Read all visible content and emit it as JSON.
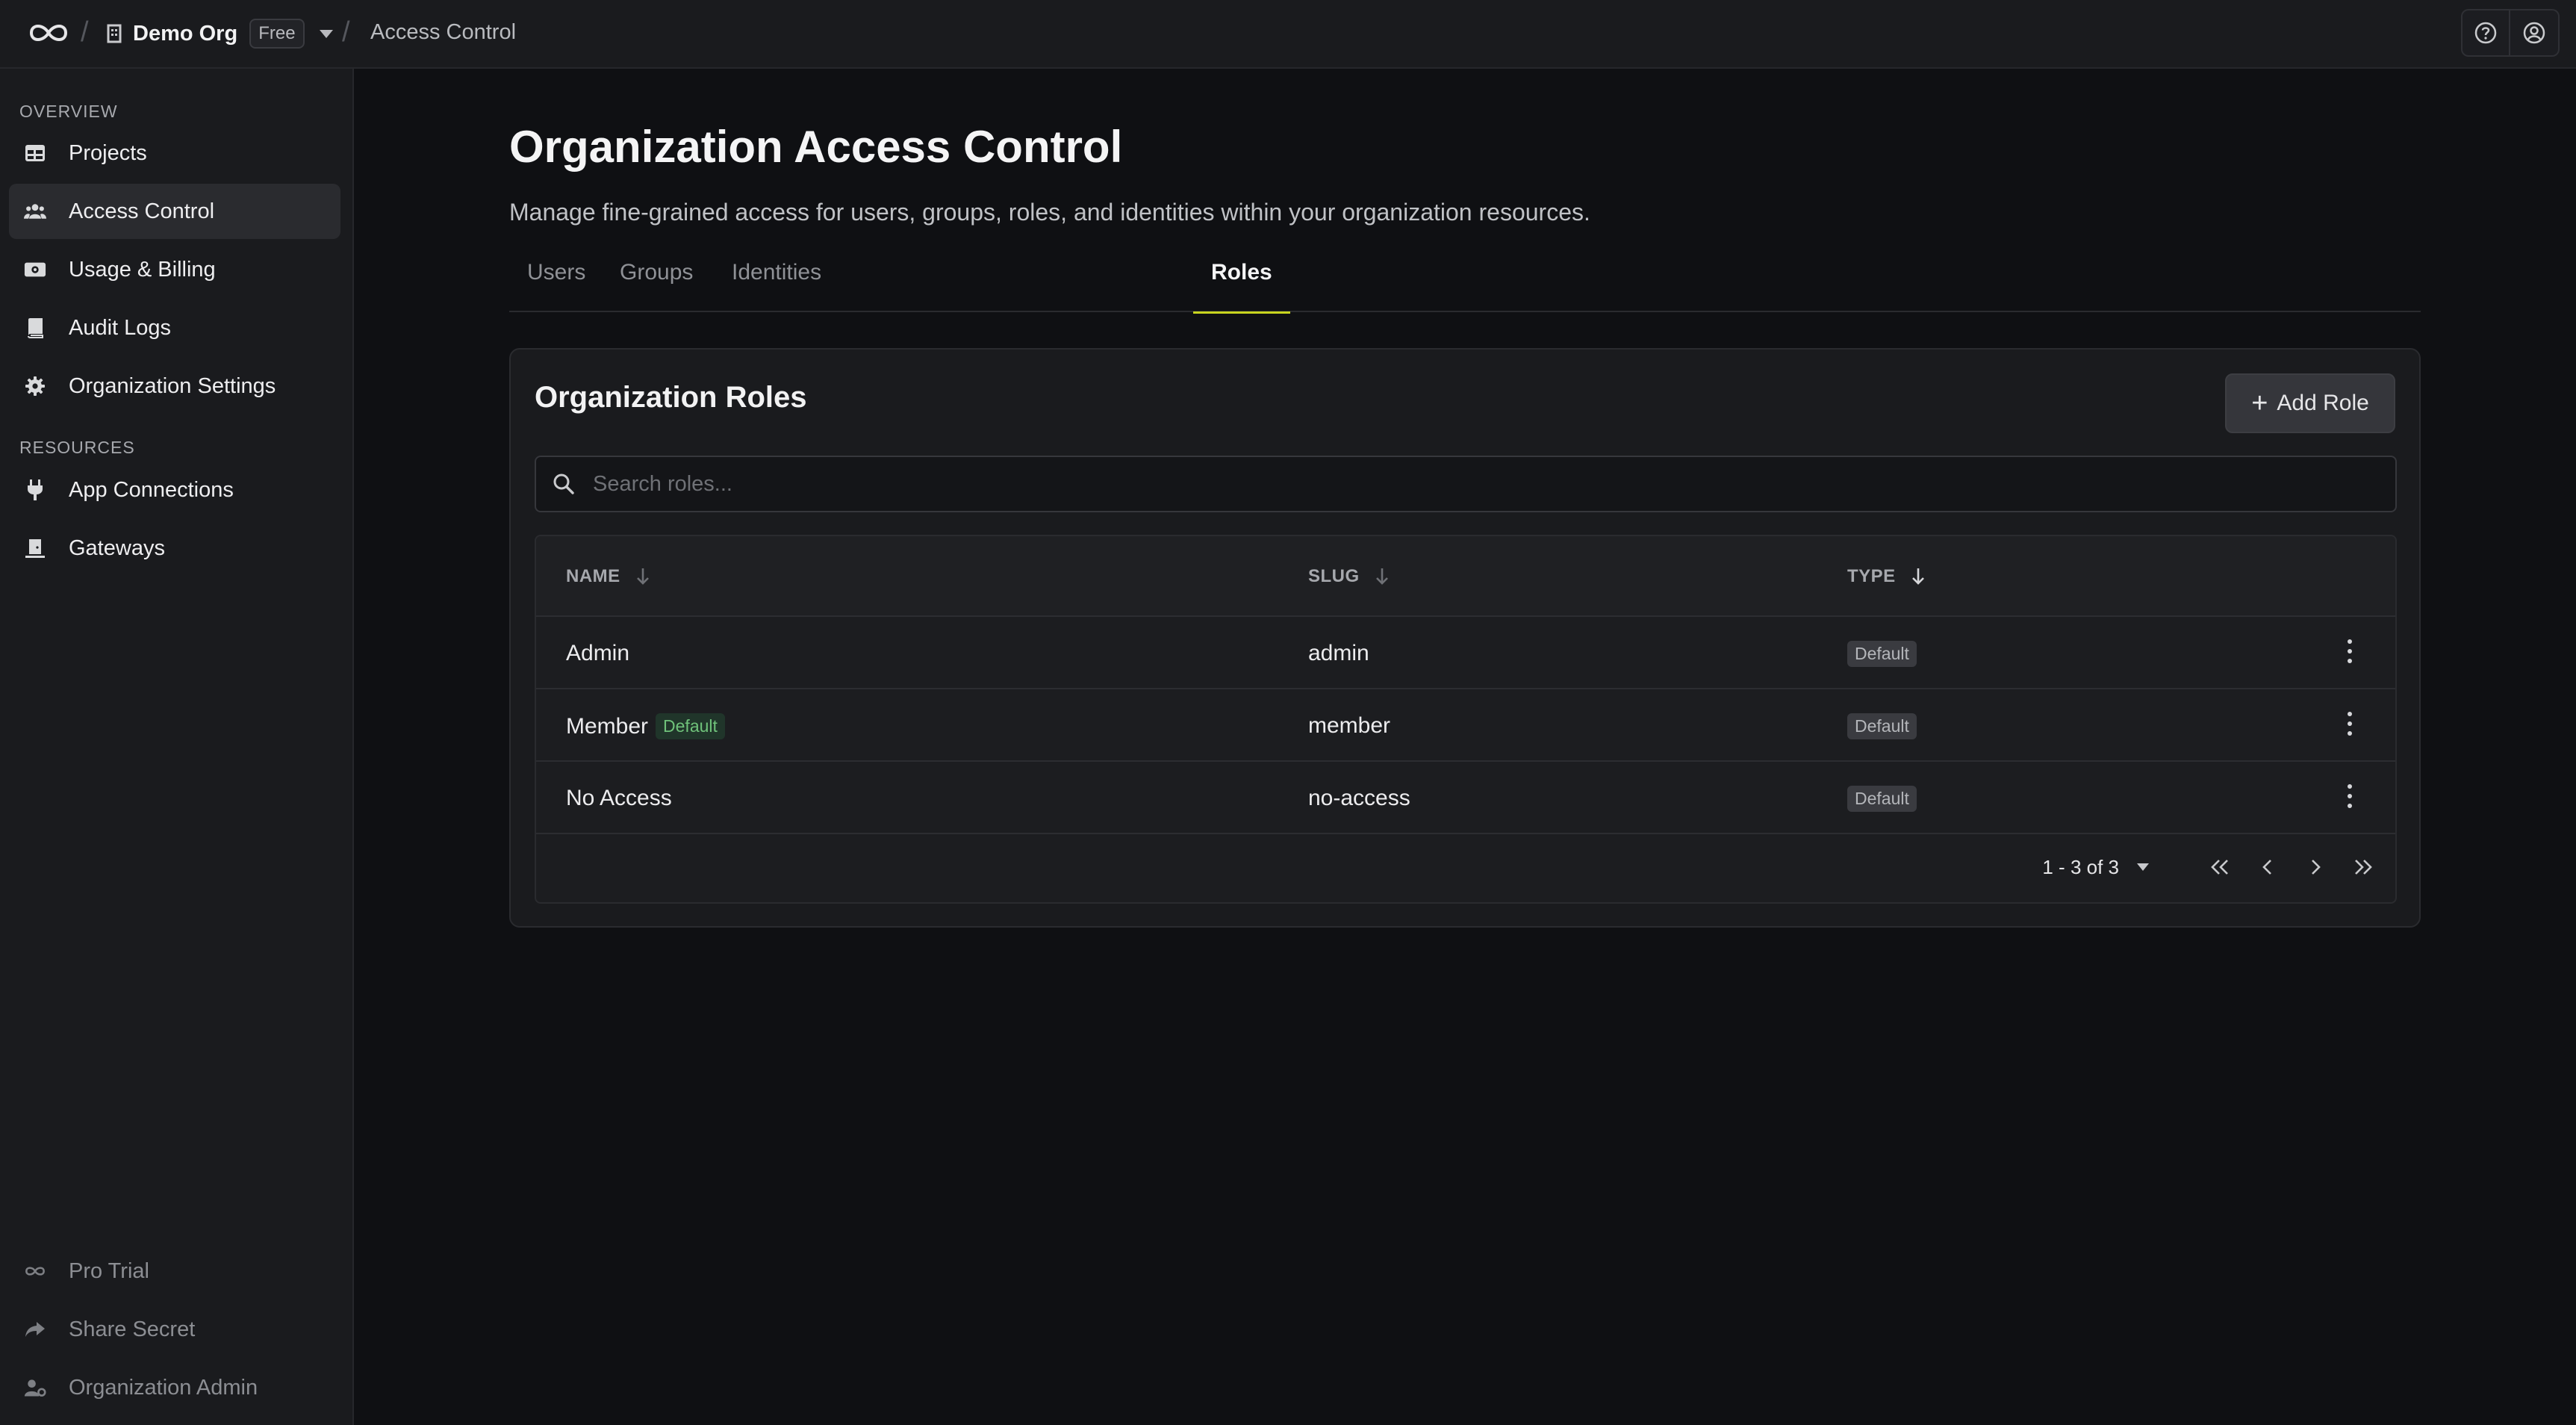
{
  "topbar": {
    "org_name": "Demo Org",
    "plan_badge": "Free",
    "breadcrumb": "Access Control",
    "separator": "/"
  },
  "sidebar": {
    "overview_title": "OVERVIEW",
    "resources_title": "RESOURCES",
    "overview_items": [
      {
        "label": "Projects",
        "icon": "table-icon"
      },
      {
        "label": "Access Control",
        "icon": "users-icon",
        "active": true
      },
      {
        "label": "Usage & Billing",
        "icon": "money-icon"
      },
      {
        "label": "Audit Logs",
        "icon": "book-icon"
      },
      {
        "label": "Organization Settings",
        "icon": "gear-icon"
      }
    ],
    "resource_items": [
      {
        "label": "App Connections",
        "icon": "plug-icon"
      },
      {
        "label": "Gateways",
        "icon": "gateway-icon"
      }
    ],
    "footer_items": [
      {
        "label": "Pro Trial",
        "icon": "infinity-icon"
      },
      {
        "label": "Share Secret",
        "icon": "share-icon"
      },
      {
        "label": "Organization Admin",
        "icon": "user-gear-icon"
      }
    ]
  },
  "page": {
    "title": "Organization Access Control",
    "subtitle": "Manage fine-grained access for users, groups, roles, and identities within your organization resources.",
    "tabs": [
      {
        "label": "Users"
      },
      {
        "label": "Groups"
      },
      {
        "label": "Identities"
      },
      {
        "label": "Roles",
        "active": true
      }
    ]
  },
  "roles_card": {
    "title": "Organization Roles",
    "add_button": "Add Role",
    "search_placeholder": "Search roles...",
    "columns": {
      "name": "NAME",
      "slug": "SLUG",
      "type": "TYPE"
    },
    "rows": [
      {
        "name": "Admin",
        "slug": "admin",
        "type": "Default",
        "badge": ""
      },
      {
        "name": "Member",
        "slug": "member",
        "type": "Default",
        "badge": "Default"
      },
      {
        "name": "No Access",
        "slug": "no-access",
        "type": "Default",
        "badge": ""
      }
    ],
    "pagination": {
      "range": "1 - 3 of 3"
    }
  },
  "colors": {
    "accent": "#c8d41e",
    "background": "#0f1013",
    "panel": "#1a1b1e",
    "badge_green": "#6fc27a"
  }
}
